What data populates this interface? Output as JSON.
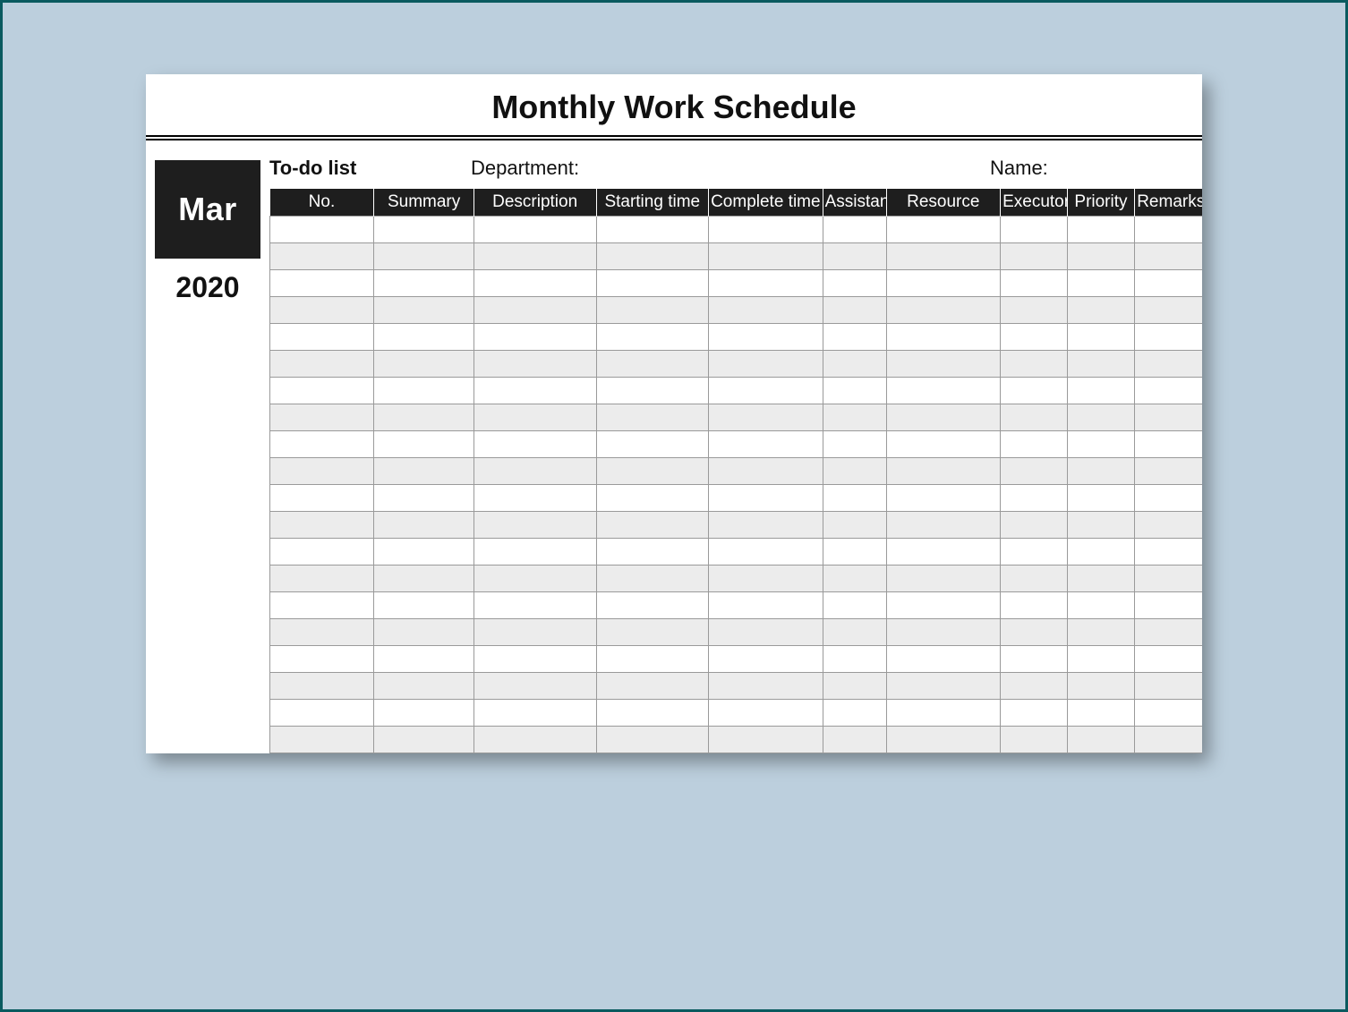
{
  "title": "Monthly Work Schedule",
  "side": {
    "month": "Mar",
    "year": "2020"
  },
  "meta": {
    "todo_label": "To-do list",
    "department_label": "Department:",
    "name_label": "Name:"
  },
  "columns": [
    "No.",
    "Summary",
    "Description",
    "Starting time",
    "Complete time",
    "Assistant",
    "Resource",
    "Executor",
    "Priority",
    "Remarks"
  ],
  "row_count": 20
}
